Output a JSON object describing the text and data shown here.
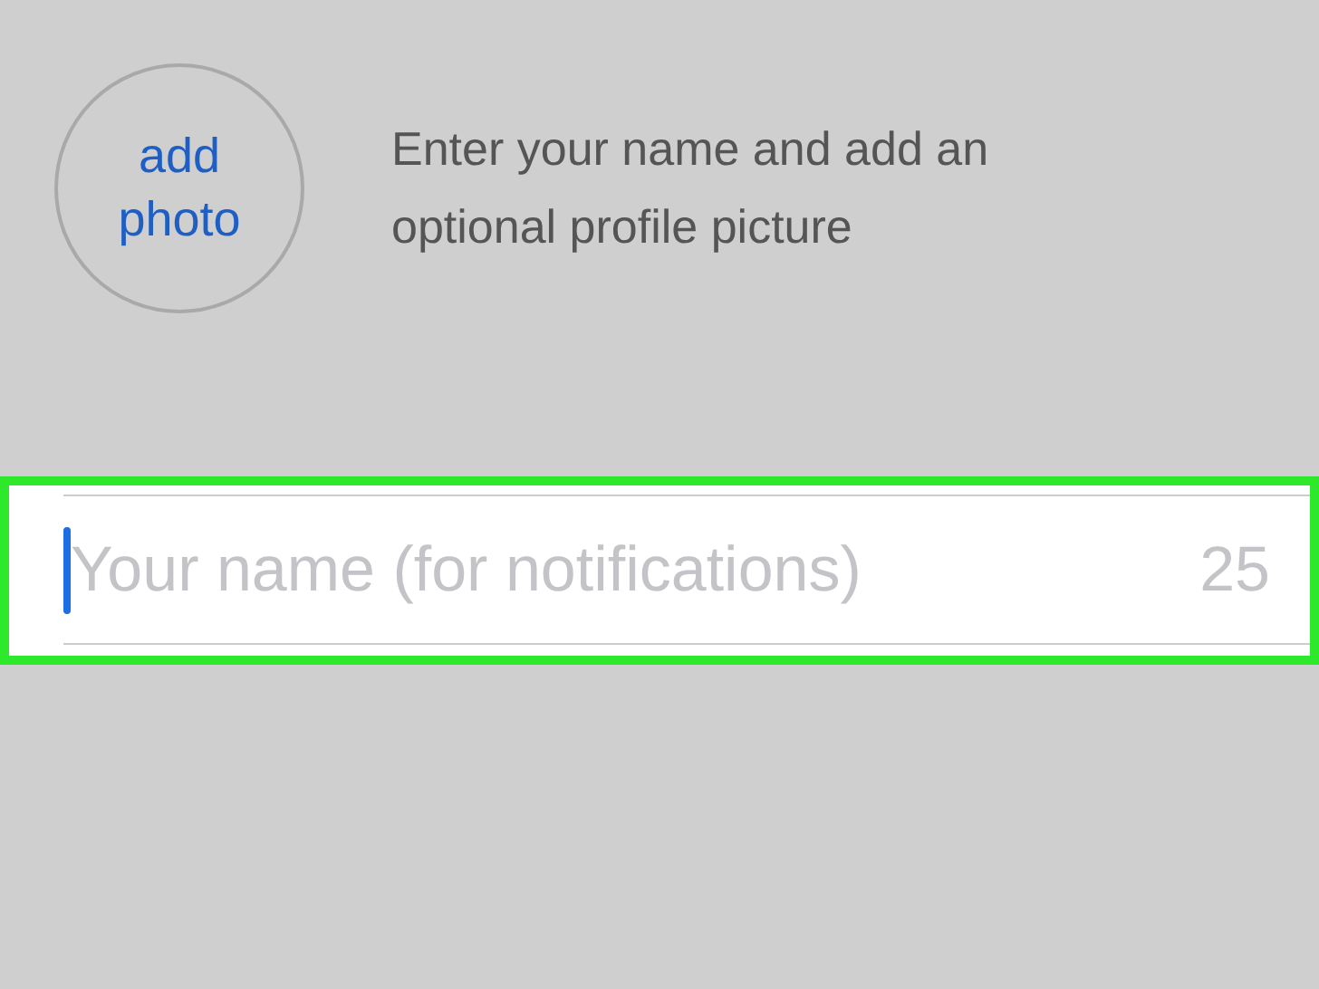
{
  "profile": {
    "photo_button": "add photo",
    "instructions": "Enter your name and add an optional profile picture"
  },
  "name_field": {
    "placeholder": "Your name (for notifications)",
    "counter": "25",
    "focused": true,
    "highlighted": true
  }
}
